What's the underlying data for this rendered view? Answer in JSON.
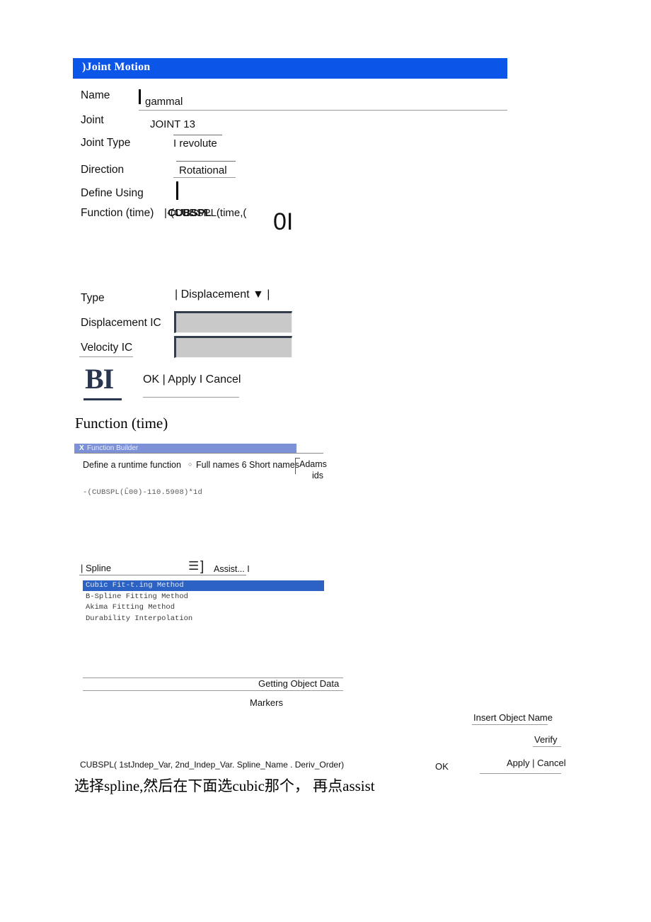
{
  "joint_motion": {
    "title": ")Joint Motion",
    "fields": [
      {
        "label": "Name",
        "value": "gammal"
      },
      {
        "label": "Joint",
        "value": "JOINT 13"
      },
      {
        "label": "Joint Type",
        "value": "I revolute"
      },
      {
        "label": "Direction",
        "value": "Rotational"
      },
      {
        "label": "Define Using",
        "value": ""
      },
      {
        "label": "Function (time)",
        "value": "|-(CUBSPL(time,("
      }
    ],
    "overlap_text": "CUBSPL",
    "stray_text": "0I"
  },
  "motion_ic": {
    "type_label": "Type",
    "type_value": "| Displacement ▼ |",
    "displacement_ic_label": "Displacement IC",
    "displacement_ic_value": "",
    "velocity_ic_label": "Velocity IC",
    "velocity_ic_value": "",
    "bi_mark": "BI",
    "buttons": "OK | Apply I Cancel"
  },
  "function_section": {
    "heading": "Function (time)"
  },
  "function_builder": {
    "close_icon": "X",
    "title": "Function Builder",
    "define_label": "Define a runtime function",
    "radio_icon": "○",
    "names_option": "Full names 6 Short names",
    "adams_line1": "Adams",
    "adams_line2": "ids",
    "formula": "-(CUBSPL(Ĺ̀00)-110.5908)*1d",
    "spline_label": "| Spline",
    "menu_icon": "☰",
    "bracket_icon": "]",
    "assist_label": "Assist... I",
    "fit_methods": [
      "Cubic Fit-t.ing Method",
      "B-Spline Fitting Method",
      "Akima Fitting Method",
      "Durability Interpolation"
    ],
    "selected_fit_method_index": 0,
    "getting_object_data": "Getting Object Data",
    "markers": "Markers",
    "insert_object_name": "Insert Object Name",
    "verify": "Verify",
    "ok": "OK",
    "apply_cancel": "Apply | Cancel"
  },
  "footer": {
    "cubspl_signature": "CUBSPL( 1stJndep_Var, 2nd_Indep_Var. Spline_Name . Deriv_Order)",
    "caption": "选择spline,然后在下面选cubic那个， 再点assist"
  },
  "colors": {
    "titlebar_blue": "#0B55E8",
    "fb_titlebar_blue": "#7D91D6",
    "selection_blue": "#2B62C4",
    "field_gray": "#C9C9C9",
    "bi_navy": "#2A3550"
  }
}
